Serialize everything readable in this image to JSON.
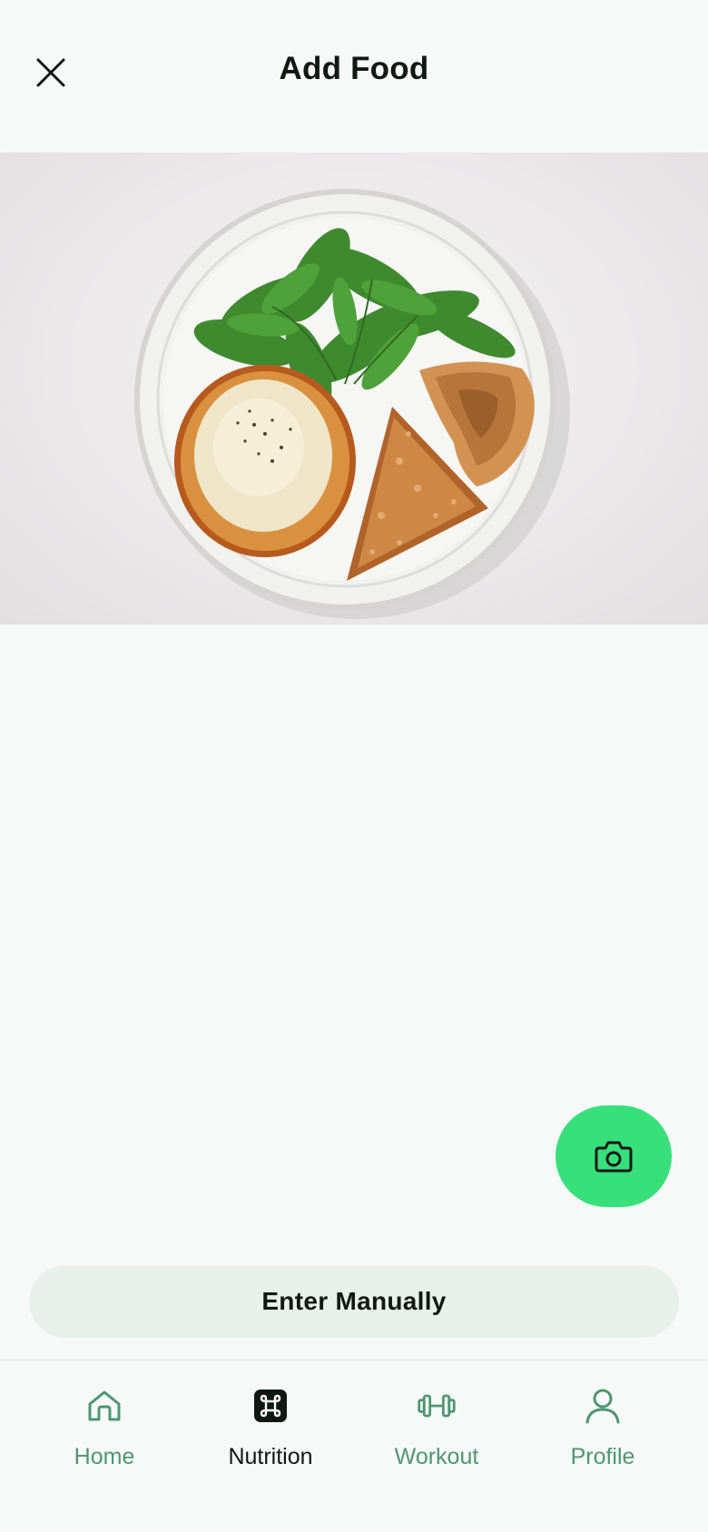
{
  "header": {
    "title": "Add Food",
    "close_icon": "close-icon"
  },
  "photo": {
    "subject": "food-photo"
  },
  "fab": {
    "icon": "camera-icon",
    "color": "#38e07b"
  },
  "manual_entry": {
    "label": "Enter Manually"
  },
  "bottom_nav": {
    "items": [
      {
        "label": "Home",
        "icon": "home-icon",
        "active": false
      },
      {
        "label": "Nutrition",
        "icon": "command-icon",
        "active": true
      },
      {
        "label": "Workout",
        "icon": "dumbbell-icon",
        "active": false
      },
      {
        "label": "Profile",
        "icon": "person-icon",
        "active": false
      }
    ],
    "active_color": "#111814",
    "inactive_color": "#4f9670"
  }
}
